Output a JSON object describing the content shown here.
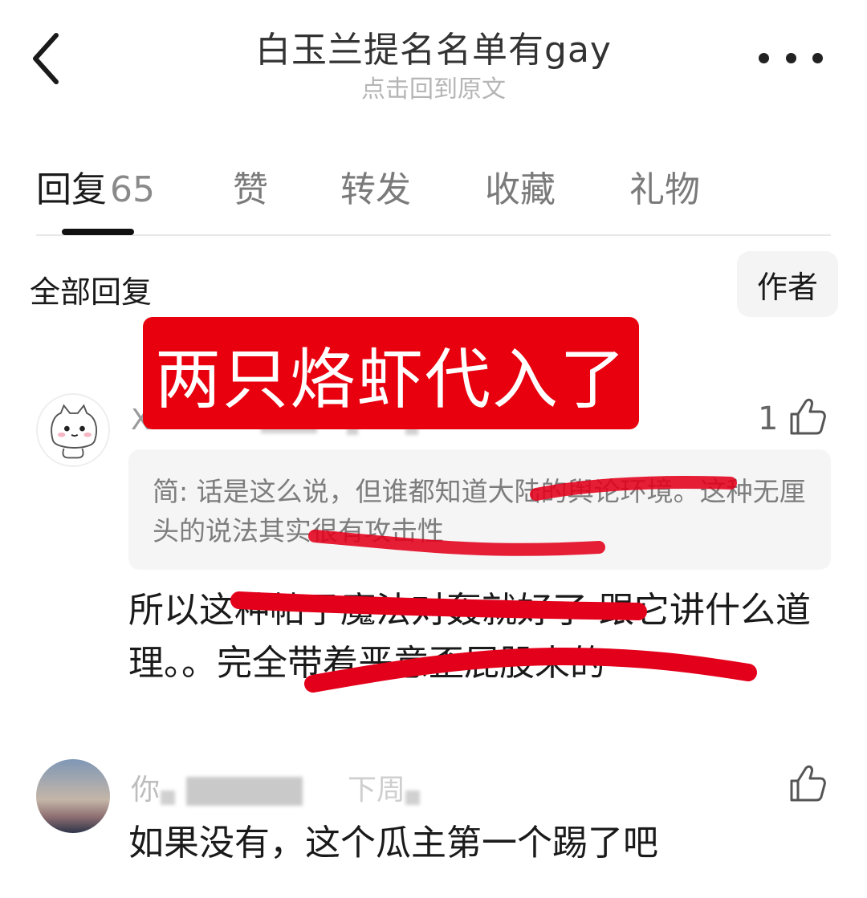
{
  "header": {
    "title": "白玉兰提名名单有gay",
    "subtitle": "点击回到原文"
  },
  "tabs": [
    {
      "label": "回复",
      "count": "65"
    },
    {
      "label": "赞"
    },
    {
      "label": "转发"
    },
    {
      "label": "收藏"
    },
    {
      "label": "礼物"
    }
  ],
  "section": {
    "title": "全部回复",
    "filter_label": "作者"
  },
  "banner": {
    "text": "两只烙虾代入了",
    "color": "#e8000e"
  },
  "comments": [
    {
      "username_visible": "X",
      "likes": "1",
      "quote": {
        "prefix": "简:",
        "text": "话是这么说，但谁都知道大陆的舆论环境。这种无厘头的说法其实很有攻击性"
      },
      "text": "所以这种帖子魔法对轰就好了 跟它讲什么道理。。完全带着恶意歪屁股来的"
    },
    {
      "username_visible": "你",
      "username_tail": "下周",
      "likes": "",
      "text": "如果没有，这个瓜主第一个踢了吧"
    }
  ],
  "colors": {
    "accent": "#e8000e",
    "text_primary": "#1a1a1a",
    "text_secondary": "#b5b5b5",
    "scribble": "#e3001b"
  },
  "icons": {
    "back": "chevron-left-icon",
    "more": "more-dots-icon",
    "like": "thumbs-up-icon"
  }
}
